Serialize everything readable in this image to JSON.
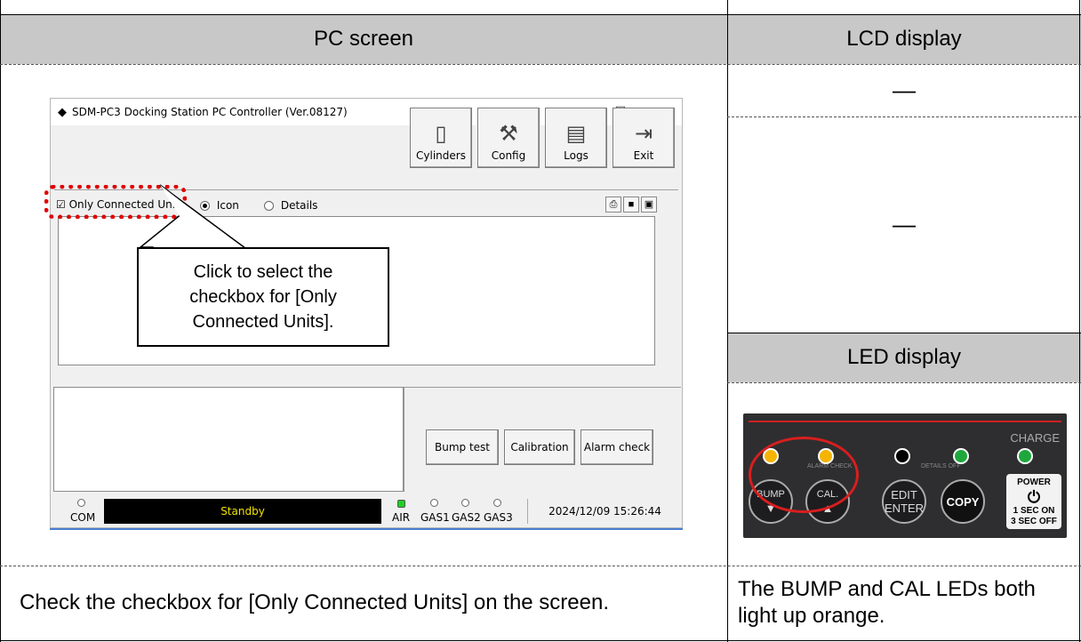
{
  "table": {
    "header_pc": "PC screen",
    "header_lcd": "LCD display",
    "header_led": "LED display",
    "lcd_value_1": "—",
    "lcd_value_2": "—",
    "caption_pc": "Check the checkbox for [Only Connected Units] on the screen.",
    "caption_led": "The BUMP and CAL LEDs both light up orange."
  },
  "window": {
    "title": "SDM-PC3 Docking Station PC Controller (Ver.08127)",
    "minimize": "–",
    "maximize": "☐",
    "close": "✕",
    "toolbar": {
      "cylinders": "Cylinders",
      "config": "Config",
      "logs": "Logs",
      "exit": "Exit"
    },
    "filter": {
      "only_connected_units": "Only Connected Units",
      "only_connected_checked": "☑",
      "view_icon": "Icon",
      "view_details": "Details"
    },
    "actions": {
      "bump_test": "Bump test",
      "calibration": "Calibration",
      "alarm_check": "Alarm check"
    },
    "statusbar": {
      "com": "COM",
      "status": "Standby",
      "air": "AIR",
      "gas1": "GAS1",
      "gas2": "GAS2",
      "gas3": "GAS3",
      "datetime": "2024/12/09 15:26:44"
    }
  },
  "callout": {
    "text": "Click to select the checkbox for [Only Connected Units]."
  },
  "led_panel": {
    "charge": "CHARGE",
    "alarm_check": "ALARM CHECK",
    "details_off": "DETAILS OFF",
    "bump": "BUMP",
    "cal": "CAL.",
    "edit": "EDIT",
    "enter": "ENTER",
    "copy": "COPY",
    "power": "POWER",
    "power_on": "1 SEC ON",
    "power_off": "3 SEC OFF",
    "down_arrow": "▼",
    "up_arrow": "▲",
    "power_icon": "⏻",
    "colors": {
      "orange": "#f5b400",
      "green": "#1ea83c",
      "off": "#000000",
      "highlight": "#d81e1e"
    }
  }
}
